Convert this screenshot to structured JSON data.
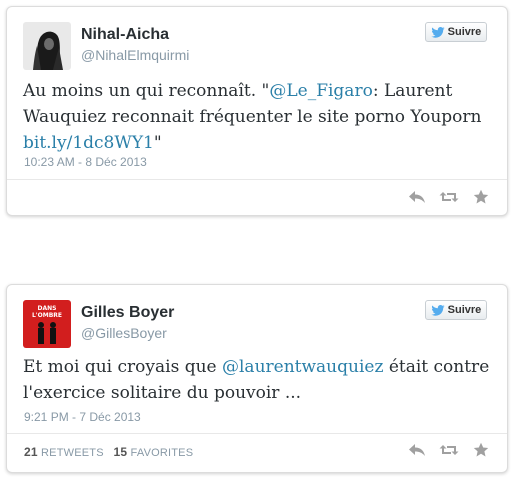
{
  "tweets": [
    {
      "name": "Nihal-Aicha",
      "handle": "@NihalElmquirmi",
      "follow_label": "Suivre",
      "text_pre": "Au moins un qui reconnaît. \"",
      "mention": "@Le_Figaro",
      "text_mid": ": Laurent Wauquiez reconnait fréquenter le site porno Youporn ",
      "link": "bit.ly/1dc8WY1",
      "text_post": "\"",
      "timestamp": "10:23 AM - 8 Déc 2013"
    },
    {
      "name": "Gilles Boyer",
      "handle": "@GillesBoyer",
      "follow_label": "Suivre",
      "avatar_text_1": "DANS",
      "avatar_text_2": "L'OMBRE",
      "text_pre": "Et moi qui croyais que ",
      "mention": "@laurentwauquiez",
      "text_post": " était contre l'exercice solitaire du pouvoir ...",
      "timestamp": "9:21 PM - 7 Déc 2013",
      "retweets_count": "21",
      "retweets_label": "RETWEETS",
      "favorites_count": "15",
      "favorites_label": "FAVORITES"
    }
  ],
  "colors": {
    "link": "#2a7fa8",
    "twitter_bird": "#55acee",
    "action_icon": "#a0a0a0",
    "avatar2_bg": "#d21e1e"
  },
  "icons": [
    "twitter-bird-icon",
    "reply-icon",
    "retweet-icon",
    "favorite-star-icon"
  ]
}
